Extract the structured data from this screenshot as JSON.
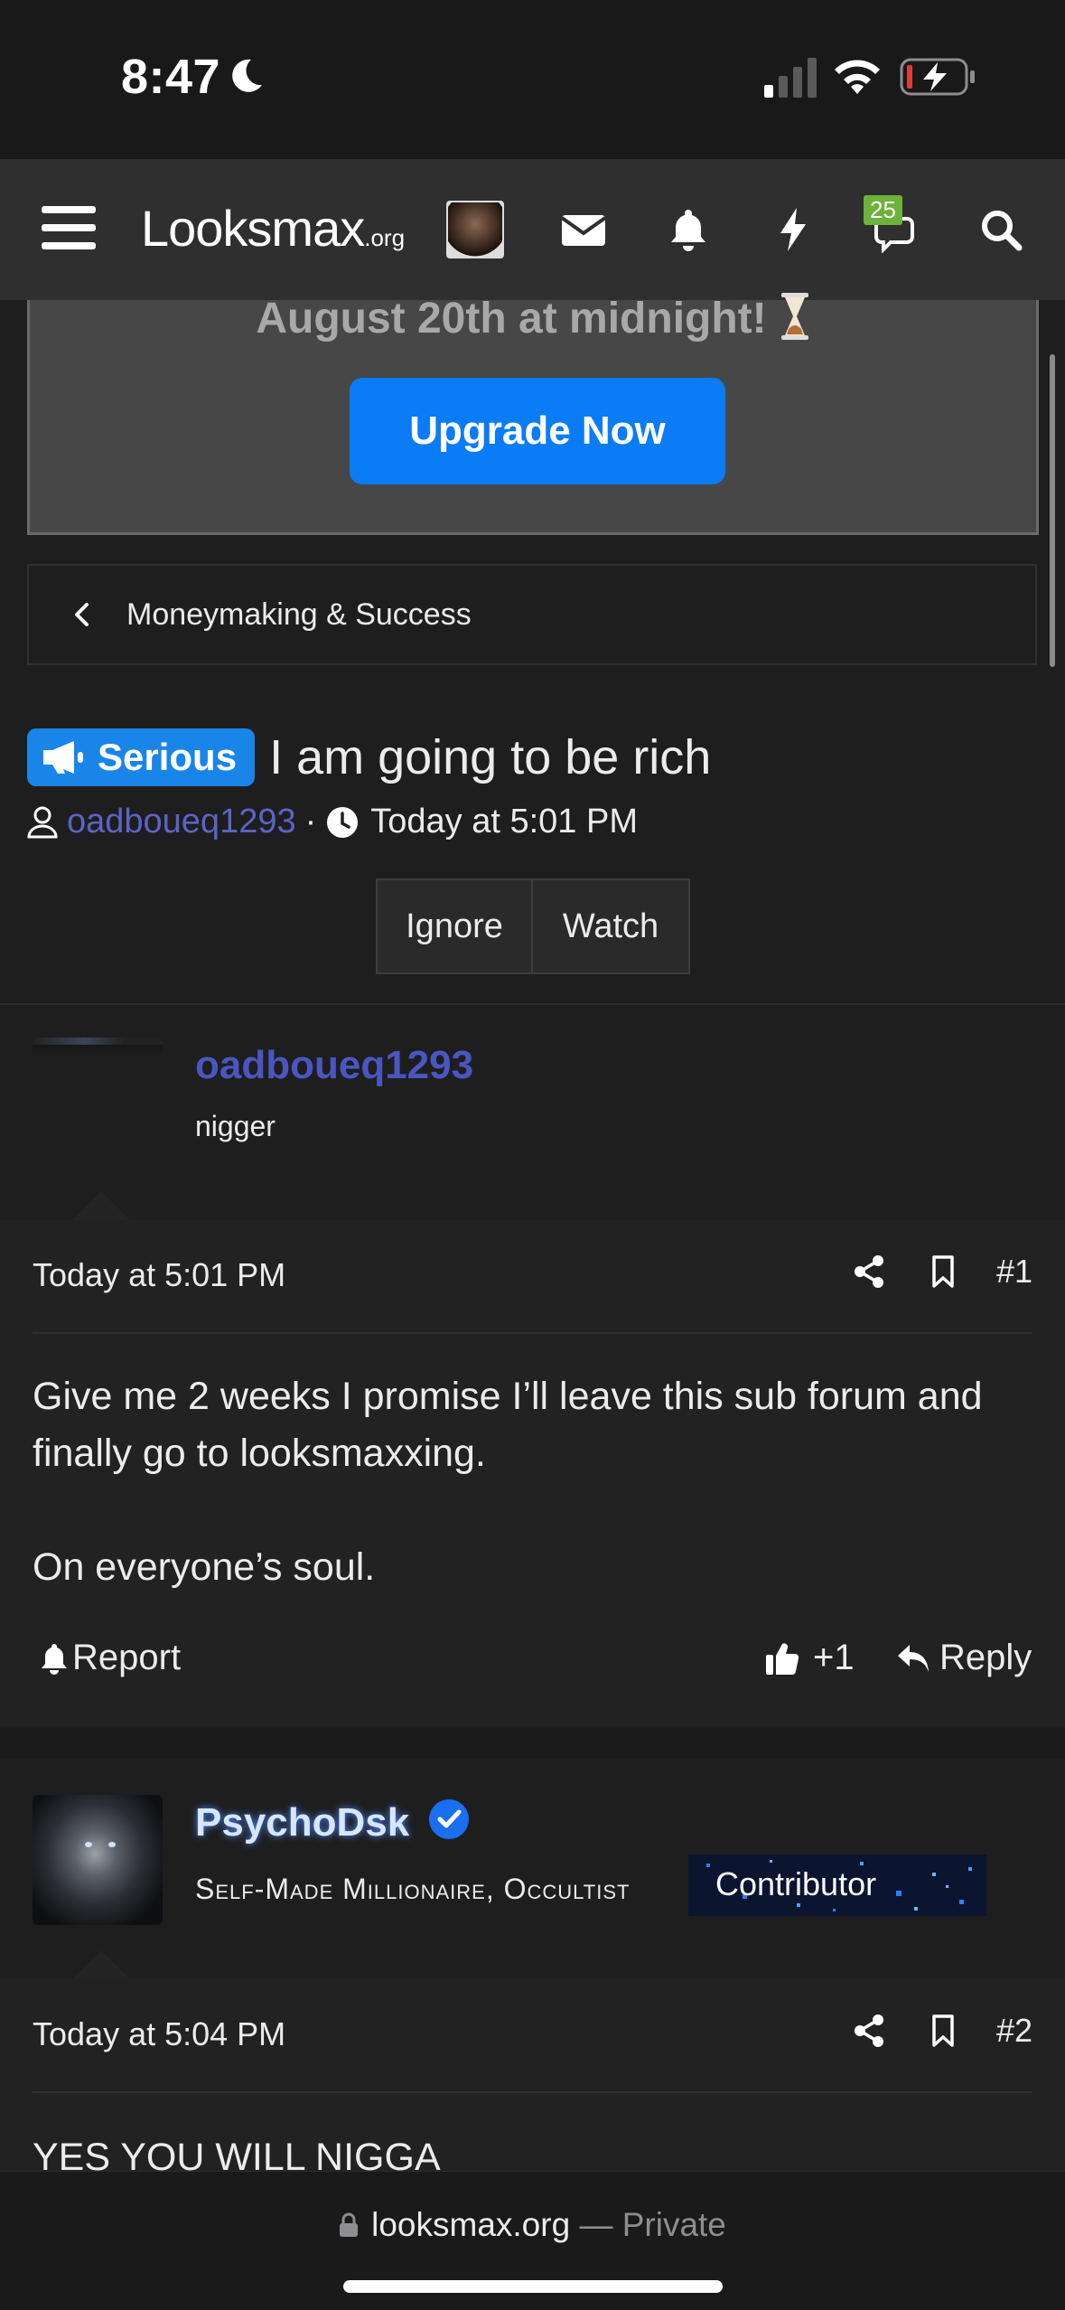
{
  "status_bar": {
    "time": "8:47"
  },
  "navbar": {
    "logo": "Looksmax",
    "logo_suffix": ".org",
    "alerts_badge": "25"
  },
  "banner": {
    "text": "August 20th at midnight!",
    "upgrade_label": "Upgrade Now"
  },
  "breadcrumb": {
    "label": "Moneymaking & Success"
  },
  "thread": {
    "prefix": "Serious",
    "title": "I am going to be rich",
    "author": "oadboueq1293",
    "separator": "·",
    "time": "Today at 5:01 PM",
    "ignore_label": "Ignore",
    "watch_label": "Watch"
  },
  "posts": [
    {
      "username": "oadboueq1293",
      "user_title": "nigger",
      "date": "Today at 5:01 PM",
      "number": "#1",
      "paragraphs": [
        "Give me 2 weeks I promise I’ll leave this sub forum and finally go to looksmaxxing.",
        "On everyone’s soul."
      ],
      "report_label": "Report",
      "like_label": "+1",
      "reply_label": "Reply"
    },
    {
      "username": "PsychoDsk",
      "user_title": "Self-Made Millionaire, Occultist",
      "banner": "Contributor",
      "date": "Today at 5:04 PM",
      "number": "#2",
      "paragraphs": [
        "YES YOU WILL NIGGA"
      ]
    }
  ],
  "url_bar": {
    "domain": "looksmax.org",
    "dash": "—",
    "mode": "Private"
  },
  "colors": {
    "accent_blue": "#0a7cf5",
    "username_link": "#5b64c4",
    "badge_green": "#6bb33a",
    "background": "#1e1e1f"
  }
}
